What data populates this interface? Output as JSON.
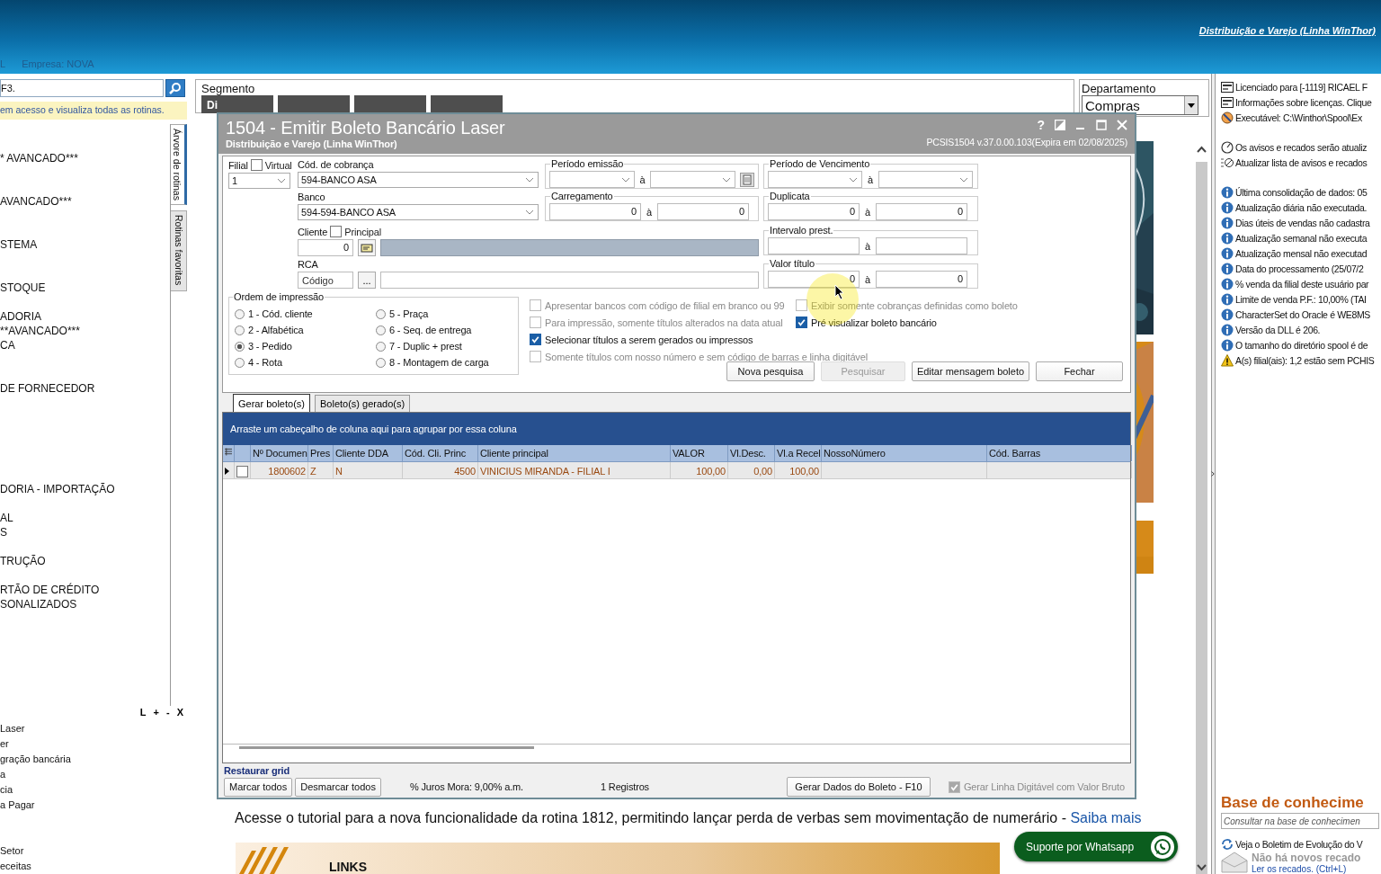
{
  "header": {
    "link": "Distribuição e Varejo (Linha WinThor)",
    "module": "L",
    "company": "Empresa: NOVA"
  },
  "left_panel": {
    "search": {
      "value": "F3."
    },
    "notice": "em acesso e visualiza todas as rotinas.",
    "tree": [
      "* AVANCADO***",
      "AVANCADO***",
      "STEMA",
      "STOQUE",
      "ADORIA",
      "**AVANCADO***",
      "CA",
      "DE FORNECEDOR",
      "DORIA - IMPORTAÇÃO",
      "AL",
      "S",
      "TRUÇÃO",
      "RTÃO DE CRÉDITO",
      "SONALIZADOS"
    ],
    "side_tabs": [
      {
        "label": "Árvore de rotinas",
        "selected": true
      },
      {
        "label": "Rotinas favoritas",
        "selected": false
      }
    ],
    "tools": [
      "L",
      "+",
      "-",
      "X"
    ],
    "recent": [
      "Laser",
      "er",
      "gração bancária",
      "a",
      "cia",
      "a Pagar",
      "Setor",
      "eceitas"
    ]
  },
  "segment": {
    "label": "Segmento",
    "first_tab": "Di"
  },
  "department": {
    "label": "Departamento",
    "value": "Compras"
  },
  "page": {
    "tutorial": "Acesse o tutorial para a nova funcionalidade da rotina 1812, permitindo lançar perda de verbas sem movimentação de numerário - ",
    "link": "Saiba mais",
    "banner": "LINKS"
  },
  "whatsapp": "Suporte por Whatsapp",
  "right_panel": {
    "groups": [
      {
        "items": [
          {
            "kind": "license",
            "text": "Licenciado para [-1119] RICAEL F"
          },
          {
            "kind": "license",
            "text": "Informações sobre licenças. Clique"
          },
          {
            "kind": "executable",
            "text": "Executável: C:\\Winthor\\Spool\\Ex"
          }
        ]
      },
      {
        "items": [
          {
            "kind": "timer",
            "text": "Os avisos e recados serão atualiz"
          },
          {
            "kind": "refresh",
            "text": "Atualizar lista de avisos e recados"
          }
        ]
      },
      {
        "items": [
          {
            "kind": "info",
            "text": "Última consolidação de dados: 05"
          },
          {
            "kind": "info",
            "text": "Atualização diária não executada."
          },
          {
            "kind": "info",
            "text": "Dias úteis de vendas não cadastra"
          },
          {
            "kind": "info",
            "text": "Atualização semanal não executa"
          },
          {
            "kind": "info",
            "text": "Atualização mensal não executad"
          },
          {
            "kind": "info",
            "text": "Data do processamento (25/07/2"
          },
          {
            "kind": "info",
            "text": "% venda da filial deste usuário par"
          },
          {
            "kind": "info",
            "text": "Limite de venda P.F.: 10,00% (TAI"
          },
          {
            "kind": "info",
            "text": "CharacterSet do Oracle é WE8MS"
          },
          {
            "kind": "info",
            "text": "Versão da DLL é 206."
          },
          {
            "kind": "info",
            "text": "O tamanho do diretório spool é de"
          },
          {
            "kind": "warning",
            "text": "A(s) filial(ais): 1,2 estão sem PCHIS"
          }
        ]
      }
    ],
    "knowledge": {
      "title": "Base de conhecime",
      "placeholder": "Consultar na base de conhecimen",
      "bulletin": "Veja o Boletim de Evolução do V",
      "no_messages": "Não há novos recado",
      "read_link": "Ler os recados. (Ctrl+L)"
    }
  },
  "dialog": {
    "title": "1504 - Emitir Boleto Bancário Laser",
    "subtitle": "Distribuição e Varejo (Linha WinThor)",
    "version": "PCSIS1504  v.37.0.00.103(Expira em 02/08/2025)",
    "help": "?",
    "form": {
      "filial": {
        "label": "Filial",
        "virtual": {
          "label": "Virtual",
          "checked": false
        },
        "value": "1"
      },
      "cobranca": {
        "label": "Cód. de cobrança",
        "value": "594-BANCO ASA"
      },
      "banco": {
        "label": "Banco",
        "value": "594-594-BANCO ASA"
      },
      "cliente": {
        "label": "Cliente",
        "principal": {
          "label": "Principal",
          "checked": false
        },
        "value": "0"
      },
      "rca": {
        "label": "RCA",
        "placeholder": "Código",
        "button": "..."
      },
      "ranges": [
        {
          "label": "Período emissão",
          "kind": "date",
          "sep": "à",
          "calendar": true
        },
        {
          "label": "Carregamento",
          "kind": "number",
          "sep": "à",
          "from": "0",
          "to": "0"
        },
        {
          "label": "Período de Vencimento",
          "kind": "date",
          "sep": "à",
          "calendar": false
        },
        {
          "label": "Duplicata",
          "kind": "number",
          "sep": "à",
          "from": "0",
          "to": "0"
        },
        {
          "label": "Intervalo prest.",
          "kind": "blank",
          "sep": "à"
        },
        {
          "label": "Valor título",
          "kind": "number",
          "sep": "à",
          "from": "0",
          "to": "0"
        }
      ]
    },
    "order": {
      "label": "Ordem de impressão",
      "options": [
        {
          "label": "1 - Cód. cliente",
          "selected": false
        },
        {
          "label": "2 - Alfabética",
          "selected": false
        },
        {
          "label": "3 - Pedido",
          "selected": true
        },
        {
          "label": "4 - Rota",
          "selected": false
        },
        {
          "label": "5 - Praça",
          "selected": false
        },
        {
          "label": "6 - Seq. de entrega",
          "selected": false
        },
        {
          "label": "7 - Duplic + prest",
          "selected": false
        },
        {
          "label": "8 - Montagem de carga",
          "selected": false
        }
      ]
    },
    "checks": [
      {
        "label": "Apresentar bancos com código de filial em branco ou 99",
        "checked": false,
        "disabled": true
      },
      {
        "label": "Exibir somente cobranças definidas como boleto",
        "checked": false,
        "disabled": true
      },
      {
        "label": "Para impressão, somente títulos alterados na data atual",
        "checked": false,
        "disabled": true
      },
      {
        "label": "Pré visualizar boleto bancário",
        "checked": true,
        "disabled": false
      },
      {
        "label": "Selecionar títulos a serem gerados ou impressos",
        "checked": true,
        "disabled": false
      },
      {
        "label": "Somente títulos com nosso número e sem código de barras e linha digitável",
        "checked": false,
        "disabled": true
      }
    ],
    "buttons": [
      {
        "label": "Nova pesquisa",
        "disabled": false
      },
      {
        "label": "Pesquisar",
        "disabled": true
      },
      {
        "label": "Editar mensagem boleto",
        "disabled": false
      },
      {
        "label": "Fechar",
        "disabled": false
      }
    ],
    "tabs": [
      {
        "label": "Gerar boleto(s)",
        "selected": true
      },
      {
        "label": "Boleto(s) gerado(s)",
        "selected": false
      }
    ],
    "grid": {
      "hint": "Arraste um cabeçalho de coluna aqui para agrupar por essa coluna",
      "columns": [
        "Nº Documen",
        "Pres",
        "Cliente DDA",
        "Cód. Cli. Princ",
        "Cliente principal",
        "VALOR",
        "Vl.Desc.",
        "Vl.a Recel",
        "NossoNúmero",
        "Cód. Barras"
      ],
      "rows": [
        {
          "current": true,
          "checked": false,
          "cells": [
            "1800602",
            "Z",
            "N",
            "4500",
            "VINICIUS MIRANDA - FILIAL I",
            "100,00",
            "0,00",
            "100,00"
          ]
        }
      ]
    },
    "footer": {
      "restore": "Restaurar grid",
      "buttons": [
        "Marcar todos",
        "Desmarcar todos"
      ],
      "interest": "% Juros Mora: 9,00% a.m.",
      "count": "1 Registros",
      "generate": "Gerar Dados do Boleto - F10",
      "bruto": {
        "label": "Gerar Linha Digitável com Valor Bruto",
        "checked": true,
        "disabled": true
      }
    }
  }
}
